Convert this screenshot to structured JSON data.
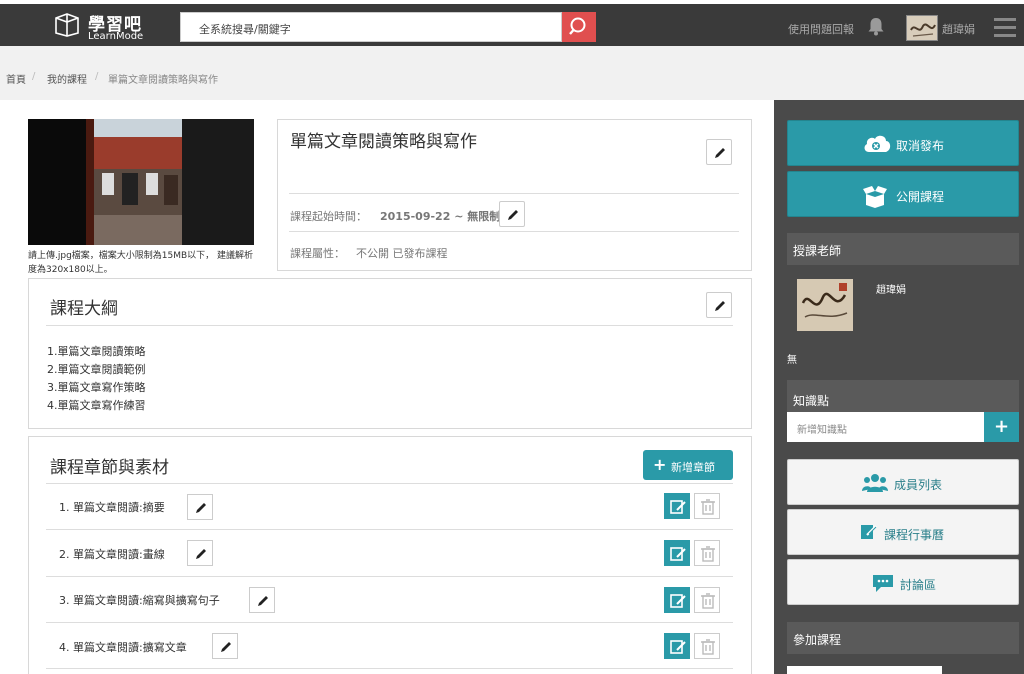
{
  "app": {
    "name": "學習吧",
    "subtitle": "LearnMode"
  },
  "header": {
    "search_text": "全系統搜尋/關鍵字",
    "help_label": "使用問題回報",
    "user_name": "趙瑋娟"
  },
  "breadcrumb": [
    "首頁",
    "我的課程",
    "單篇文章閱讀策略與寫作"
  ],
  "course": {
    "upload_note": "請上傳.jpg檔案，檔案大小限制為15MB以下， 建議解析度為320x180以上。",
    "title": "單篇文章閱讀策略與寫作",
    "start_label": "課程起始時間：",
    "start_value": "2015-09-22 ~ 無限制",
    "attr_label": "課程屬性：",
    "attr_value": "不公開 已發布課程"
  },
  "outline": {
    "title": "課程大綱",
    "items": [
      "1.單篇文章閱讀策略",
      "2.單篇文章閱讀範例",
      "3.單篇文章寫作策略",
      "4.單篇文章寫作練習"
    ]
  },
  "chapters": {
    "title": "課程章節與素材",
    "add_label": "新增章節",
    "items": [
      "1. 單篇文章閱讀:摘要",
      "2. 單篇文章閱讀:畫線",
      "3. 單篇文章閱讀:縮寫與擴寫句子",
      "4. 單篇文章閱讀:擴寫文章"
    ]
  },
  "sidebar": {
    "unpublish_label": "取消發布",
    "public_label": "公開課程",
    "teacher_heading": "授課老師",
    "teacher_name": "趙瑋娟",
    "none_label": "無",
    "knowledge_heading": "知識點",
    "knowledge_placeholder": "新增知識點",
    "members_label": "成員列表",
    "calendar_label": "課程行事曆",
    "discussion_label": "討論區",
    "join_heading": "參加課程"
  },
  "colors": {
    "accent": "#2a9aa8",
    "topbar": "#3a3a3a",
    "sidebar": "#4a4a4a",
    "search_button": "#e04f4f"
  }
}
